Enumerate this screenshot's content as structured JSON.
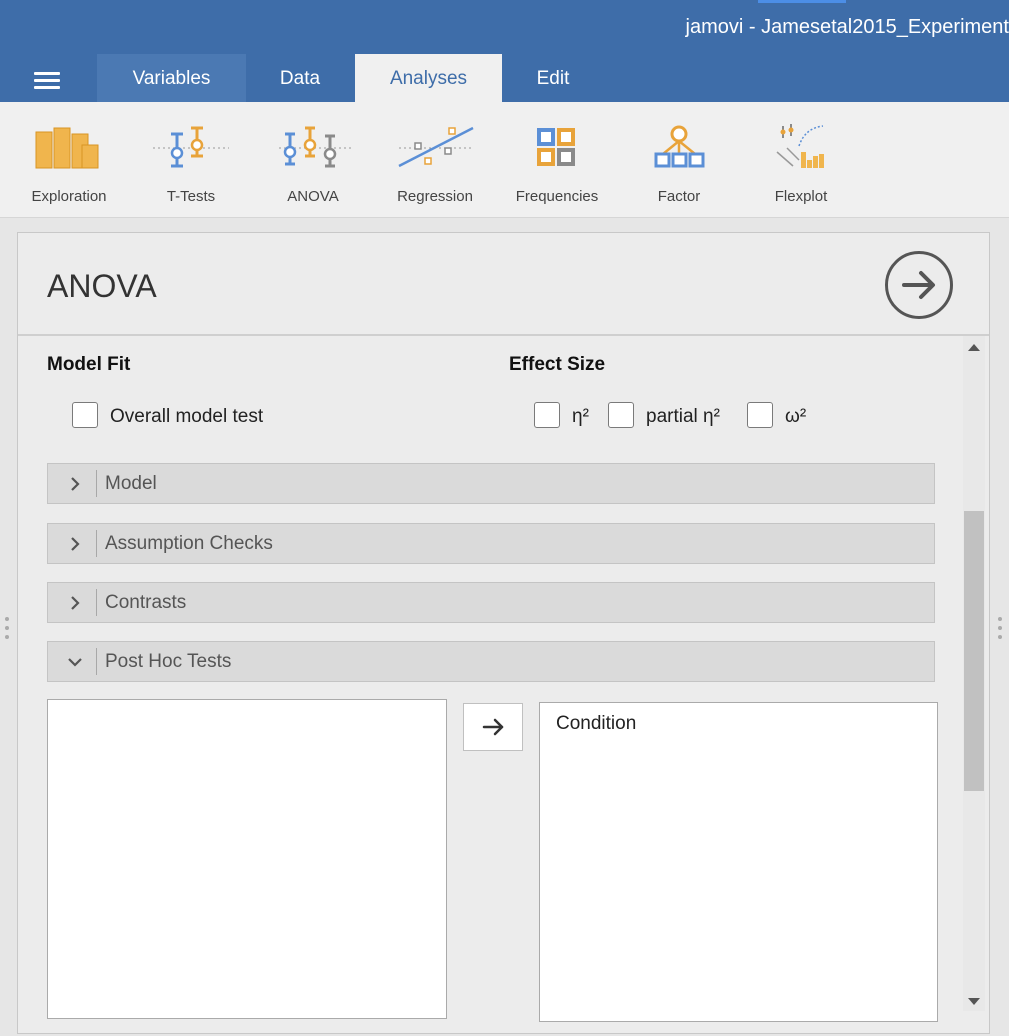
{
  "window": {
    "title": "jamovi - Jamesetal2015_Experiment"
  },
  "menu": {
    "tabs": [
      {
        "label": "Variables"
      },
      {
        "label": "Data"
      },
      {
        "label": "Analyses",
        "active": true
      },
      {
        "label": "Edit"
      }
    ]
  },
  "ribbon": {
    "items": [
      {
        "label": "Exploration",
        "icon": "exploration-icon"
      },
      {
        "label": "T-Tests",
        "icon": "t-tests-icon"
      },
      {
        "label": "ANOVA",
        "icon": "anova-icon"
      },
      {
        "label": "Regression",
        "icon": "regression-icon"
      },
      {
        "label": "Frequencies",
        "icon": "frequencies-icon"
      },
      {
        "label": "Factor",
        "icon": "factor-icon"
      },
      {
        "label": "Flexplot",
        "icon": "flexplot-icon"
      }
    ]
  },
  "panel": {
    "title": "ANOVA",
    "model_fit": {
      "label": "Model Fit",
      "overall_model_test": {
        "label": "Overall model test",
        "checked": false
      }
    },
    "effect_size": {
      "label": "Effect Size",
      "eta2": {
        "label": "η²",
        "checked": false
      },
      "partial_eta2": {
        "label": "partial η²",
        "checked": false
      },
      "omega2": {
        "label": "ω²",
        "checked": false
      }
    },
    "sections": [
      {
        "label": "Model",
        "expanded": false
      },
      {
        "label": "Assumption Checks",
        "expanded": false
      },
      {
        "label": "Contrasts",
        "expanded": false
      },
      {
        "label": "Post Hoc Tests",
        "expanded": true
      }
    ],
    "post_hoc": {
      "available": [],
      "selected": [
        "Condition"
      ]
    }
  },
  "colors": {
    "titlebar": "#3e6da9",
    "accent_orange": "#e8a33a",
    "accent_blue": "#5b8fd6",
    "accent_gray": "#8a8a8a"
  }
}
